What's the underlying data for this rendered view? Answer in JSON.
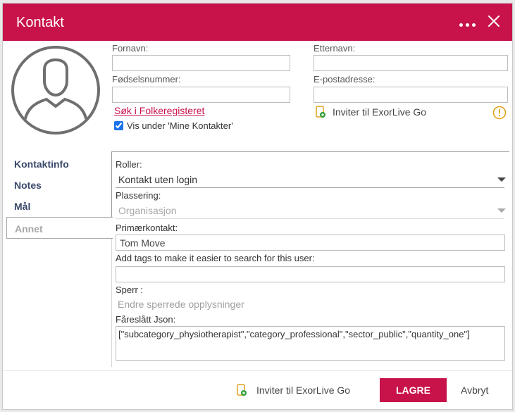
{
  "dialog": {
    "title": "Kontakt",
    "accent_color": "#c8124a",
    "more_icon": "ellipsis-icon",
    "close_icon": "close-icon"
  },
  "form": {
    "firstname_label": "Fornavn:",
    "firstname_value": "",
    "lastname_label": "Etternavn:",
    "lastname_value": "",
    "ssn_label": "Fødselsnummer:",
    "ssn_value": "",
    "email_label": "E-postadresse:",
    "email_value": "",
    "registry_link": "Søk i Folkeregisteret",
    "invite_label": "Inviter til ExorLive Go",
    "show_contacts_label": "Vis under 'Mine Kontakter'",
    "show_contacts_checked": true
  },
  "nav": {
    "items": [
      {
        "label": "Kontaktinfo"
      },
      {
        "label": "Notes"
      },
      {
        "label": "Mål"
      },
      {
        "label": "Annet"
      }
    ],
    "active": "Annet"
  },
  "annet": {
    "roles_label": "Roller:",
    "roles_value": "Kontakt uten login",
    "placement_label": "Plassering:",
    "placement_value": "Organisasjon",
    "primary_label": "Primærkontakt:",
    "primary_value": "Tom Move",
    "tags_label": "Add tags to make it easier to search for this user:",
    "tags_value": "",
    "sperr_label": "Sperr :",
    "sperr_text": "Endre sperrede opplysninger",
    "json_label": "Fåreslått Json:",
    "json_value": "[\"subcategory_physiotherapist\",\"category_professional\",\"sector_public\",\"quantity_one\"]"
  },
  "footer": {
    "invite_label": "Inviter til ExorLive Go",
    "save_label": "LAGRE",
    "cancel_label": "Avbryt"
  }
}
